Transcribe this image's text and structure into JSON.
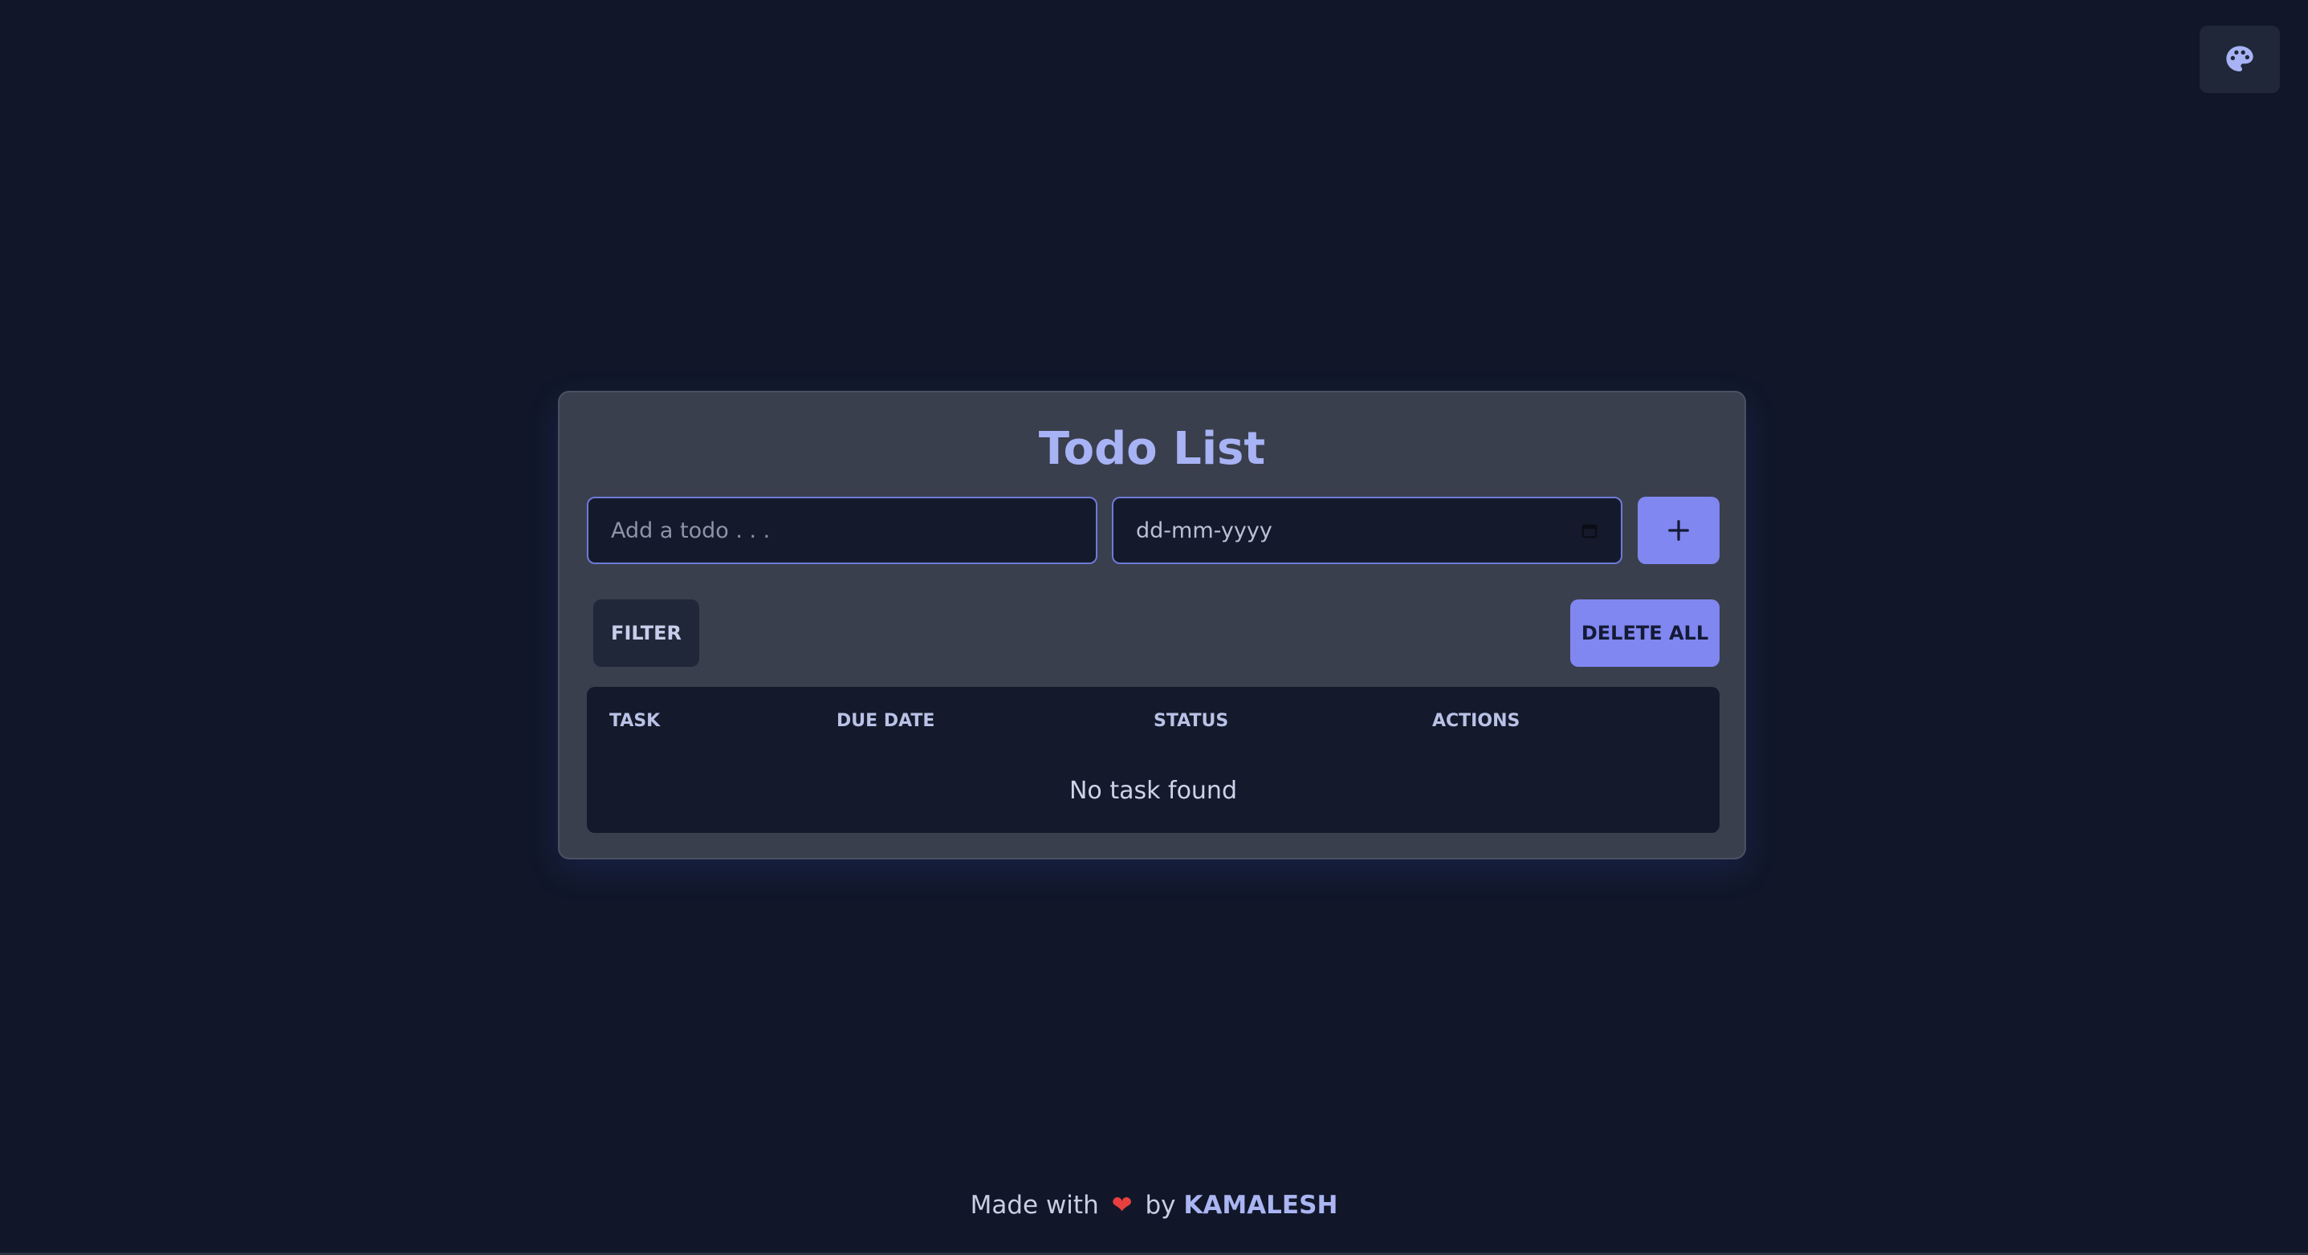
{
  "header": {
    "theme_icon": "palette-icon"
  },
  "card": {
    "title": "Todo List",
    "todo_input": {
      "value": "",
      "placeholder": "Add a todo . . ."
    },
    "date_input": {
      "placeholder": "dd-mm-yyyy",
      "icon": "calendar-icon"
    },
    "add_button": {
      "icon": "plus-icon"
    },
    "filter_label": "FILTER",
    "delete_all_label": "DELETE ALL",
    "table": {
      "columns": [
        "TASK",
        "DUE DATE",
        "STATUS",
        "ACTIONS"
      ],
      "rows": [],
      "empty_message": "No task found"
    }
  },
  "footer": {
    "prefix": "Made with",
    "heart": "❤",
    "by": "by",
    "author": "KAMALESH"
  },
  "colors": {
    "background": "#111729",
    "card": "#3a3f4d",
    "accent": "#8087f0",
    "title": "#a8b3f5",
    "heart": "#e8403f"
  }
}
